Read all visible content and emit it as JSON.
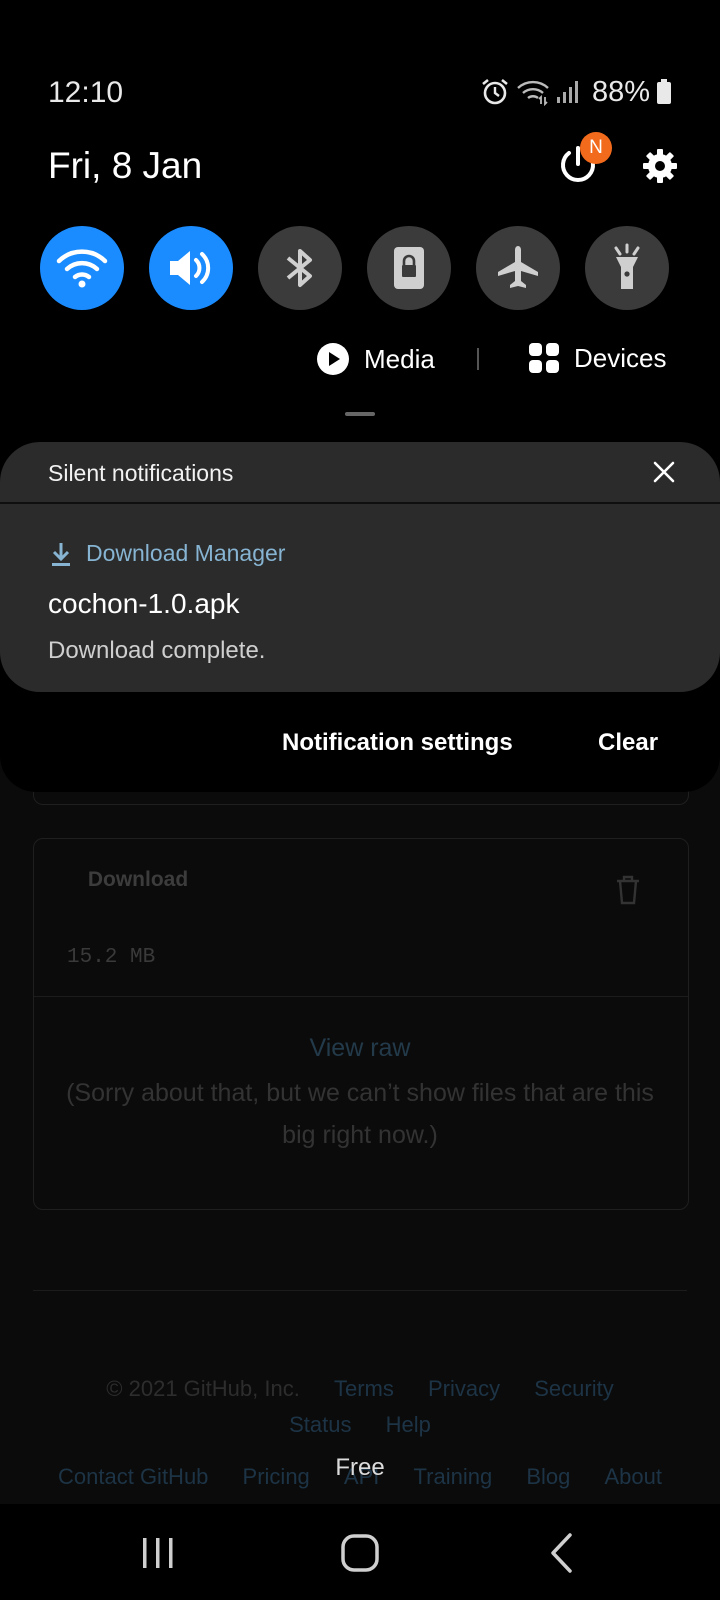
{
  "status_bar": {
    "time": "12:10",
    "battery": "88%",
    "icons": [
      "alarm-icon",
      "wifi-signal-icon",
      "cell-signal-icon",
      "battery-icon"
    ]
  },
  "shade": {
    "date": "Fri, 8 Jan",
    "power_badge": "N",
    "quick_settings": [
      {
        "name": "wifi",
        "icon": "wifi-icon",
        "active": true
      },
      {
        "name": "sound",
        "icon": "sound-icon",
        "active": true
      },
      {
        "name": "bluetooth",
        "icon": "bluetooth-icon",
        "active": false
      },
      {
        "name": "portrait",
        "icon": "rotation-lock-icon",
        "active": false
      },
      {
        "name": "airplane",
        "icon": "airplane-icon",
        "active": false
      },
      {
        "name": "flashlight",
        "icon": "flashlight-icon",
        "active": false
      }
    ],
    "media_label": "Media",
    "devices_label": "Devices",
    "accent_color": "#1a8cff"
  },
  "notifications": {
    "section_title": "Silent notifications",
    "app_name": "Download Manager",
    "title": "cochon-1.0.apk",
    "body": "Download complete.",
    "settings_label": "Notification settings",
    "clear_label": "Clear"
  },
  "background_page": {
    "download_label": "Download",
    "file_size": "15.2 MB",
    "view_raw": "View raw",
    "sorry_text": "(Sorry about that, but we can’t show files that are this big right now.)",
    "footer": {
      "copyright": "© 2021 GitHub, Inc.",
      "row1_links": [
        "Terms",
        "Privacy",
        "Security"
      ],
      "row2_links": [
        "Status",
        "Help"
      ],
      "row3_links": [
        "Contact GitHub",
        "Pricing",
        "API",
        "Training",
        "Blog",
        "About"
      ]
    },
    "free_label": "Free"
  }
}
